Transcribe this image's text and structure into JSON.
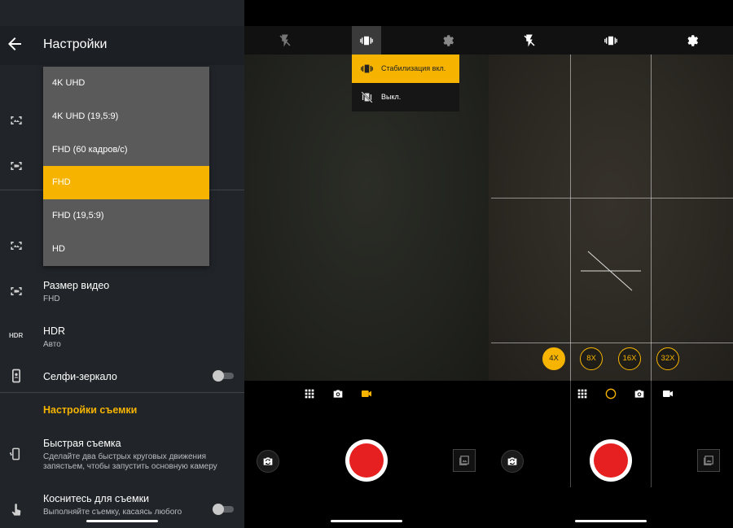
{
  "settings": {
    "title": "Настройки",
    "dropdown": {
      "options": [
        "4K UHD",
        "4K UHD (19,5:9)",
        "FHD (60 кадров/с)",
        "FHD",
        "FHD (19,5:9)",
        "HD"
      ],
      "selected": "FHD"
    },
    "video_size": {
      "label": "Размер видео",
      "value": "FHD"
    },
    "hdr": {
      "icon_text": "HDR",
      "label": "HDR",
      "value": "Авто"
    },
    "selfie_mirror": {
      "label": "Селфи-зеркало",
      "enabled": false
    },
    "section_capture": "Настройки съемки",
    "quick_capture": {
      "label": "Быстрая съемка",
      "description": "Сделайте два быстрых круговых движения запястьем, чтобы запустить основную камеру"
    },
    "touch_capture": {
      "label": "Коснитесь для съемки",
      "description": "Выполняйте съемку, касаясь любого",
      "enabled": false
    }
  },
  "camera_stabilization": {
    "top_icons": [
      "flash-off-icon",
      "stabilization-icon",
      "gear-icon"
    ],
    "menu": {
      "on_label": "Стабилизация вкл.",
      "off_label": "Выкл."
    },
    "modes": [
      "grid-icon",
      "photo-icon",
      "video-icon"
    ],
    "active_mode": "video"
  },
  "camera_zoom": {
    "top_icons": [
      "flash-off-icon",
      "stabilization-icon",
      "gear-icon"
    ],
    "zoom_levels": [
      "4X",
      "8X",
      "16X",
      "32X"
    ],
    "active_zoom": "4X",
    "modes": [
      "grid-icon",
      "night-icon",
      "photo-icon",
      "video-icon"
    ]
  },
  "colors": {
    "accent": "#f6b400",
    "record": "#e62020",
    "settings_bg": "#212529"
  }
}
